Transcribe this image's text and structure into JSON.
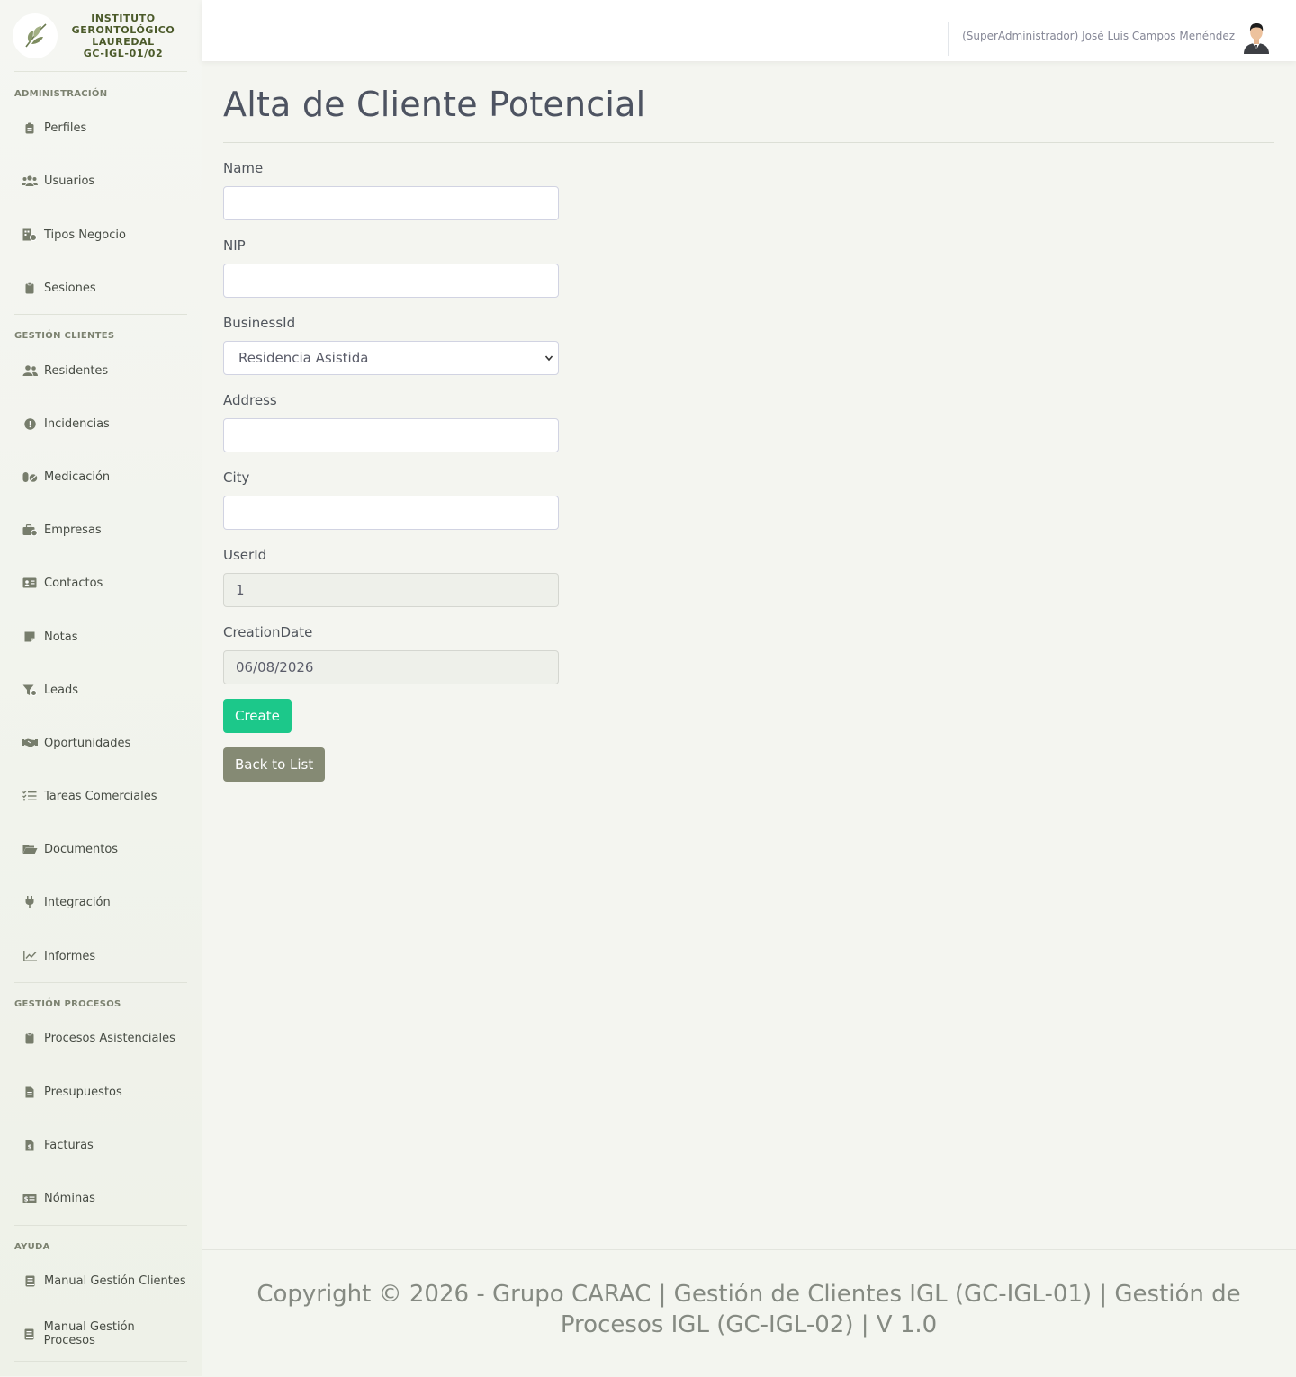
{
  "brand": {
    "line1": "INSTITUTO",
    "line2": "GERONTOLÓGICO",
    "line3": "LAUREDAL",
    "line4": "GC-IGL-01/02"
  },
  "sidebar": {
    "sections": [
      {
        "heading": "ADMINISTRACIÓN",
        "items": [
          {
            "label": "Perfiles",
            "icon": "badge-icon"
          },
          {
            "label": "Usuarios",
            "icon": "users-icon"
          },
          {
            "label": "Tipos Negocio",
            "icon": "building-icon"
          },
          {
            "label": "Sesiones",
            "icon": "clipboard-icon"
          }
        ]
      },
      {
        "heading": "GESTIÓN CLIENTES",
        "items": [
          {
            "label": "Residentes",
            "icon": "user-group-icon"
          },
          {
            "label": "Incidencias",
            "icon": "exclamation-circle-icon"
          },
          {
            "label": "Medicación",
            "icon": "pills-icon"
          },
          {
            "label": "Empresas",
            "icon": "briefcase-icon"
          },
          {
            "label": "Contactos",
            "icon": "id-card-icon"
          },
          {
            "label": "Notas",
            "icon": "sticky-note-icon"
          },
          {
            "label": "Leads",
            "icon": "funnel-icon"
          },
          {
            "label": "Oportunidades",
            "icon": "handshake-icon"
          },
          {
            "label": "Tareas Comerciales",
            "icon": "task-list-icon"
          },
          {
            "label": "Documentos",
            "icon": "folder-open-icon"
          },
          {
            "label": "Integración",
            "icon": "plug-icon"
          },
          {
            "label": "Informes",
            "icon": "line-chart-icon"
          }
        ]
      },
      {
        "heading": "GESTIÓN PROCESOS",
        "items": [
          {
            "label": "Procesos Asistenciales",
            "icon": "clipboard-icon"
          },
          {
            "label": "Presupuestos",
            "icon": "file-text-icon"
          },
          {
            "label": "Facturas",
            "icon": "file-invoice-icon"
          },
          {
            "label": "Nóminas",
            "icon": "money-check-icon"
          }
        ]
      },
      {
        "heading": "AYUDA",
        "items": [
          {
            "label": "Manual Gestión Clientes",
            "icon": "book-icon"
          },
          {
            "label": "Manual Gestión Procesos",
            "icon": "book-icon"
          }
        ]
      }
    ]
  },
  "topbar": {
    "user": "(SuperAdministrador) José Luis Campos Menéndez",
    "avatar_icon": "user-avatar-icon"
  },
  "page": {
    "title": "Alta de Cliente Potencial"
  },
  "form": {
    "name_label": "Name",
    "name_value": "",
    "nip_label": "NIP",
    "nip_value": "",
    "business_label": "BusinessId",
    "business_value": "Residencia Asistida",
    "address_label": "Address",
    "address_value": "",
    "city_label": "City",
    "city_value": "",
    "userid_label": "UserId",
    "userid_value": "1",
    "creation_label": "CreationDate",
    "creation_value": "06/08/2026",
    "create_button": "Create",
    "back_button": "Back to List"
  },
  "footer": {
    "text": "Copyright © 2026 - Grupo CARAC | Gestión de Clientes IGL (GC-IGL-01) | Gestión de Procesos IGL (GC-IGL-02) | V 1.0"
  },
  "colors": {
    "accent_green": "#1cc88a",
    "back_button": "#858a74",
    "brand_text": "#4b5a2a"
  }
}
